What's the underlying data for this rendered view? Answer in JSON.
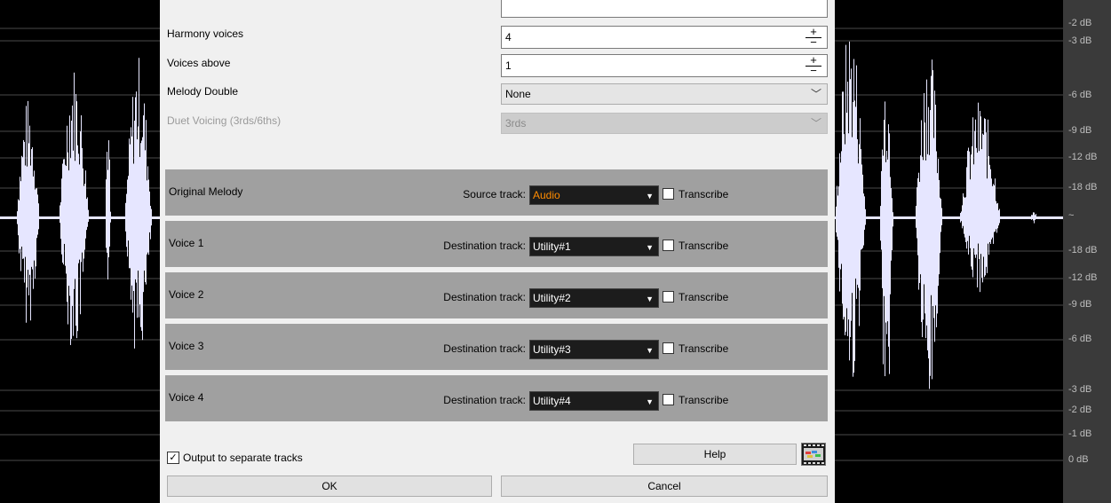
{
  "db_labels": [
    "-2 dB",
    "-3 dB",
    "-6 dB",
    "-9 dB",
    "-12 dB",
    "-18 dB",
    "~",
    "-18 dB",
    "-12 dB",
    "-9 dB",
    "-6 dB",
    "-3 dB",
    "-2 dB",
    "-1 dB",
    "0 dB"
  ],
  "form": {
    "harmony_voices_label": "Harmony voices",
    "harmony_voices_value": "4",
    "voices_above_label": "Voices above",
    "voices_above_value": "1",
    "melody_double_label": "Melody Double",
    "melody_double_value": "None",
    "duet_voicing_label": "Duet Voicing (3rds/6ths)",
    "duet_voicing_value": "3rds",
    "spin_plus": "+",
    "spin_minus": "−"
  },
  "tracks": [
    {
      "name": "Original Melody",
      "dest_label": "Source track:",
      "value": "Audio",
      "transcribe": "Transcribe"
    },
    {
      "name": "Voice 1",
      "dest_label": "Destination track:",
      "value": "Utility#1",
      "transcribe": "Transcribe"
    },
    {
      "name": "Voice 2",
      "dest_label": "Destination track:",
      "value": "Utility#2",
      "transcribe": "Transcribe"
    },
    {
      "name": "Voice 3",
      "dest_label": "Destination track:",
      "value": "Utility#3",
      "transcribe": "Transcribe"
    },
    {
      "name": "Voice 4",
      "dest_label": "Destination track:",
      "value": "Utility#4",
      "transcribe": "Transcribe"
    }
  ],
  "footer": {
    "output_separate_label": "Output to separate tracks",
    "output_separate_checked": true,
    "help_label": "Help",
    "ok_label": "OK",
    "cancel_label": "Cancel"
  },
  "colors": {
    "source_track_value": "#ff8c00",
    "waveform": "#e6e6ff",
    "track_row_bg": "#a0a0a0"
  },
  "icons": {
    "dropdown": "chevron-down-icon",
    "film": "film-strip-icon",
    "check": "checkmark-icon"
  }
}
